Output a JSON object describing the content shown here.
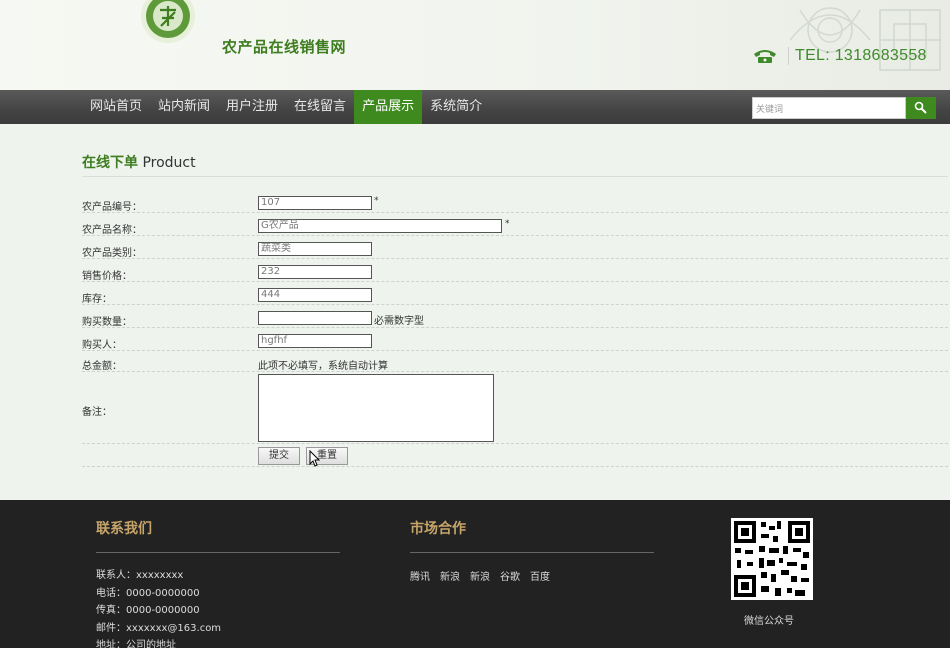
{
  "header": {
    "site_title": "农产品在线销售网",
    "tel": "TEL: 1318683558"
  },
  "nav": {
    "items": [
      {
        "label": "网站首页"
      },
      {
        "label": "站内新闻"
      },
      {
        "label": "用户注册"
      },
      {
        "label": "在线留言"
      },
      {
        "label": "产品展示"
      },
      {
        "label": "系统简介"
      }
    ],
    "active_index": 4,
    "search_placeholder": "关键词"
  },
  "section": {
    "title_cn": "在线下单",
    "title_en": "Product"
  },
  "form": {
    "fields": [
      {
        "label": "农产品编号：",
        "value": "107",
        "required": "*"
      },
      {
        "label": "农产品名称：",
        "value": "G农产品",
        "required": "*"
      },
      {
        "label": "农产品类别：",
        "value": "蔬菜类"
      },
      {
        "label": "销售价格：",
        "value": "232"
      },
      {
        "label": "库存：",
        "value": "444"
      },
      {
        "label": "购买数量：",
        "value": "",
        "hint": "必需数字型"
      },
      {
        "label": "购买人：",
        "value": "hgfhf"
      },
      {
        "label": "总金额：",
        "hint": "此项不必填写，系统自动计算"
      },
      {
        "label": "备注："
      }
    ],
    "submit_label": "提交",
    "reset_label": "重置"
  },
  "footer": {
    "contact_title": "联系我们",
    "contact_lines": [
      "联系人：xxxxxxxx",
      "电话：0000-0000000",
      "传真：0000-0000000",
      "邮件：xxxxxxx@163.com",
      "地址：公司的地址"
    ],
    "market_title": "市场合作",
    "market_links": [
      "腾讯",
      "新浪",
      "新浪",
      "谷歌",
      "百度"
    ],
    "qr_caption": "微信公众号"
  },
  "colors": {
    "brand_green": "#3e8a1e",
    "nav_bg": "#444444",
    "footer_bg": "#222222",
    "footer_title": "#c7a56a"
  }
}
